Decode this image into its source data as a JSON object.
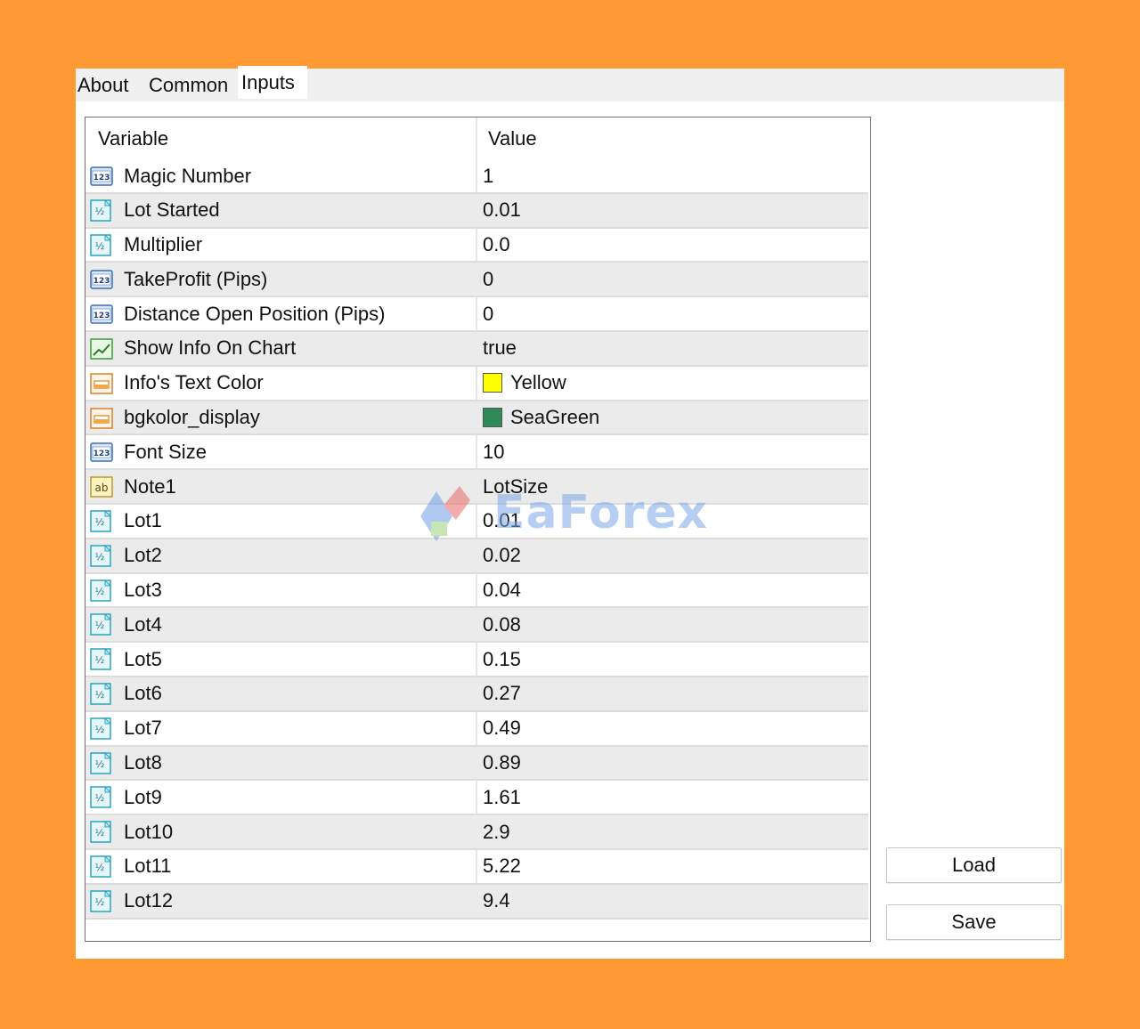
{
  "tabs": [
    {
      "label": "About"
    },
    {
      "label": "Common"
    },
    {
      "label": "Inputs"
    }
  ],
  "grid": {
    "header_variable": "Variable",
    "header_value": "Value",
    "rows": [
      {
        "name": "Magic Number",
        "value": "1",
        "icon": "integer-123-icon"
      },
      {
        "name": "Lot Started",
        "value": "0.01",
        "icon": "double-fraction-icon"
      },
      {
        "name": "Multiplier",
        "value": "0.0",
        "icon": "double-fraction-icon"
      },
      {
        "name": "TakeProfit (Pips)",
        "value": "0",
        "icon": "integer-123-icon"
      },
      {
        "name": "Distance Open Position (Pips)",
        "value": "0",
        "icon": "integer-123-icon"
      },
      {
        "name": "Show Info On Chart",
        "value": "true",
        "icon": "bool-chart-icon"
      },
      {
        "name": "Info's Text Color",
        "value": "Yellow",
        "icon": "color-icon",
        "swatch": "#FFFF00"
      },
      {
        "name": "bgkolor_display",
        "value": "SeaGreen",
        "icon": "color-icon",
        "swatch": "#2E8B57"
      },
      {
        "name": "Font Size",
        "value": "10",
        "icon": "integer-123-icon"
      },
      {
        "name": "Note1",
        "value": "LotSize",
        "icon": "string-ab-icon"
      },
      {
        "name": "Lot1",
        "value": "0.01",
        "icon": "double-fraction-icon"
      },
      {
        "name": "Lot2",
        "value": "0.02",
        "icon": "double-fraction-icon"
      },
      {
        "name": "Lot3",
        "value": "0.04",
        "icon": "double-fraction-icon"
      },
      {
        "name": "Lot4",
        "value": "0.08",
        "icon": "double-fraction-icon"
      },
      {
        "name": "Lot5",
        "value": "0.15",
        "icon": "double-fraction-icon"
      },
      {
        "name": "Lot6",
        "value": "0.27",
        "icon": "double-fraction-icon"
      },
      {
        "name": "Lot7",
        "value": "0.49",
        "icon": "double-fraction-icon"
      },
      {
        "name": "Lot8",
        "value": "0.89",
        "icon": "double-fraction-icon"
      },
      {
        "name": "Lot9",
        "value": "1.61",
        "icon": "double-fraction-icon"
      },
      {
        "name": "Lot10",
        "value": "2.9",
        "icon": "double-fraction-icon"
      },
      {
        "name": "Lot11",
        "value": "5.22",
        "icon": "double-fraction-icon"
      },
      {
        "name": "Lot12",
        "value": "9.4",
        "icon": "double-fraction-icon"
      }
    ]
  },
  "buttons": {
    "load_label": "Load",
    "save_label": "Save"
  },
  "watermark": {
    "text": "EaForex"
  }
}
